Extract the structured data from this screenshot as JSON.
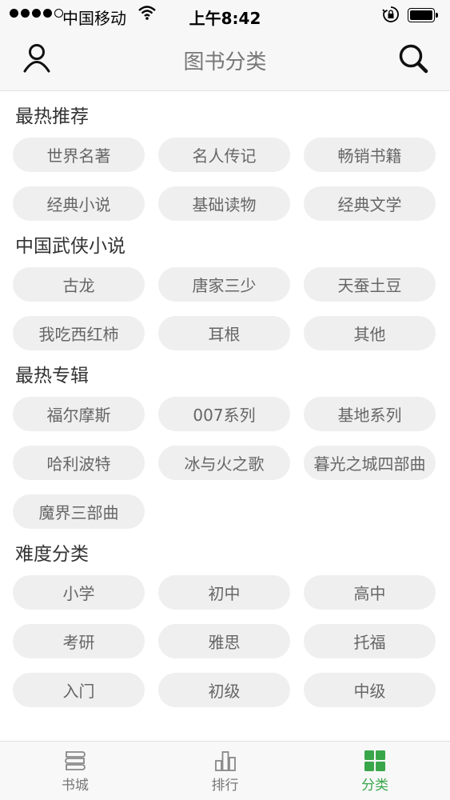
{
  "status_bar": {
    "carrier": "中国移动",
    "time": "上午8:42"
  },
  "nav": {
    "title": "图书分类",
    "left_icon": "user-icon",
    "right_icon": "search-icon"
  },
  "sections": [
    {
      "title": "最热推荐",
      "tags": [
        "世界名著",
        "名人传记",
        "畅销书籍",
        "经典小说",
        "基础读物",
        "经典文学"
      ]
    },
    {
      "title": "中国武侠小说",
      "tags": [
        "古龙",
        "唐家三少",
        "天蚕土豆",
        "我吃西红柿",
        "耳根",
        "其他"
      ]
    },
    {
      "title": "最热专辑",
      "tags": [
        "福尔摩斯",
        "007系列",
        "基地系列",
        "哈利波特",
        "冰与火之歌",
        "暮光之城四部曲",
        "魔界三部曲"
      ]
    },
    {
      "title": "难度分类",
      "tags": [
        "小学",
        "初中",
        "高中",
        "考研",
        "雅思",
        "托福",
        "入门",
        "初级",
        "中级"
      ]
    }
  ],
  "tabbar": {
    "items": [
      {
        "label": "书城",
        "icon": "bookstore-icon"
      },
      {
        "label": "排行",
        "icon": "ranking-icon"
      },
      {
        "label": "分类",
        "icon": "category-icon"
      }
    ],
    "active_color": "#3aa64a",
    "inactive_color": "#777777"
  }
}
